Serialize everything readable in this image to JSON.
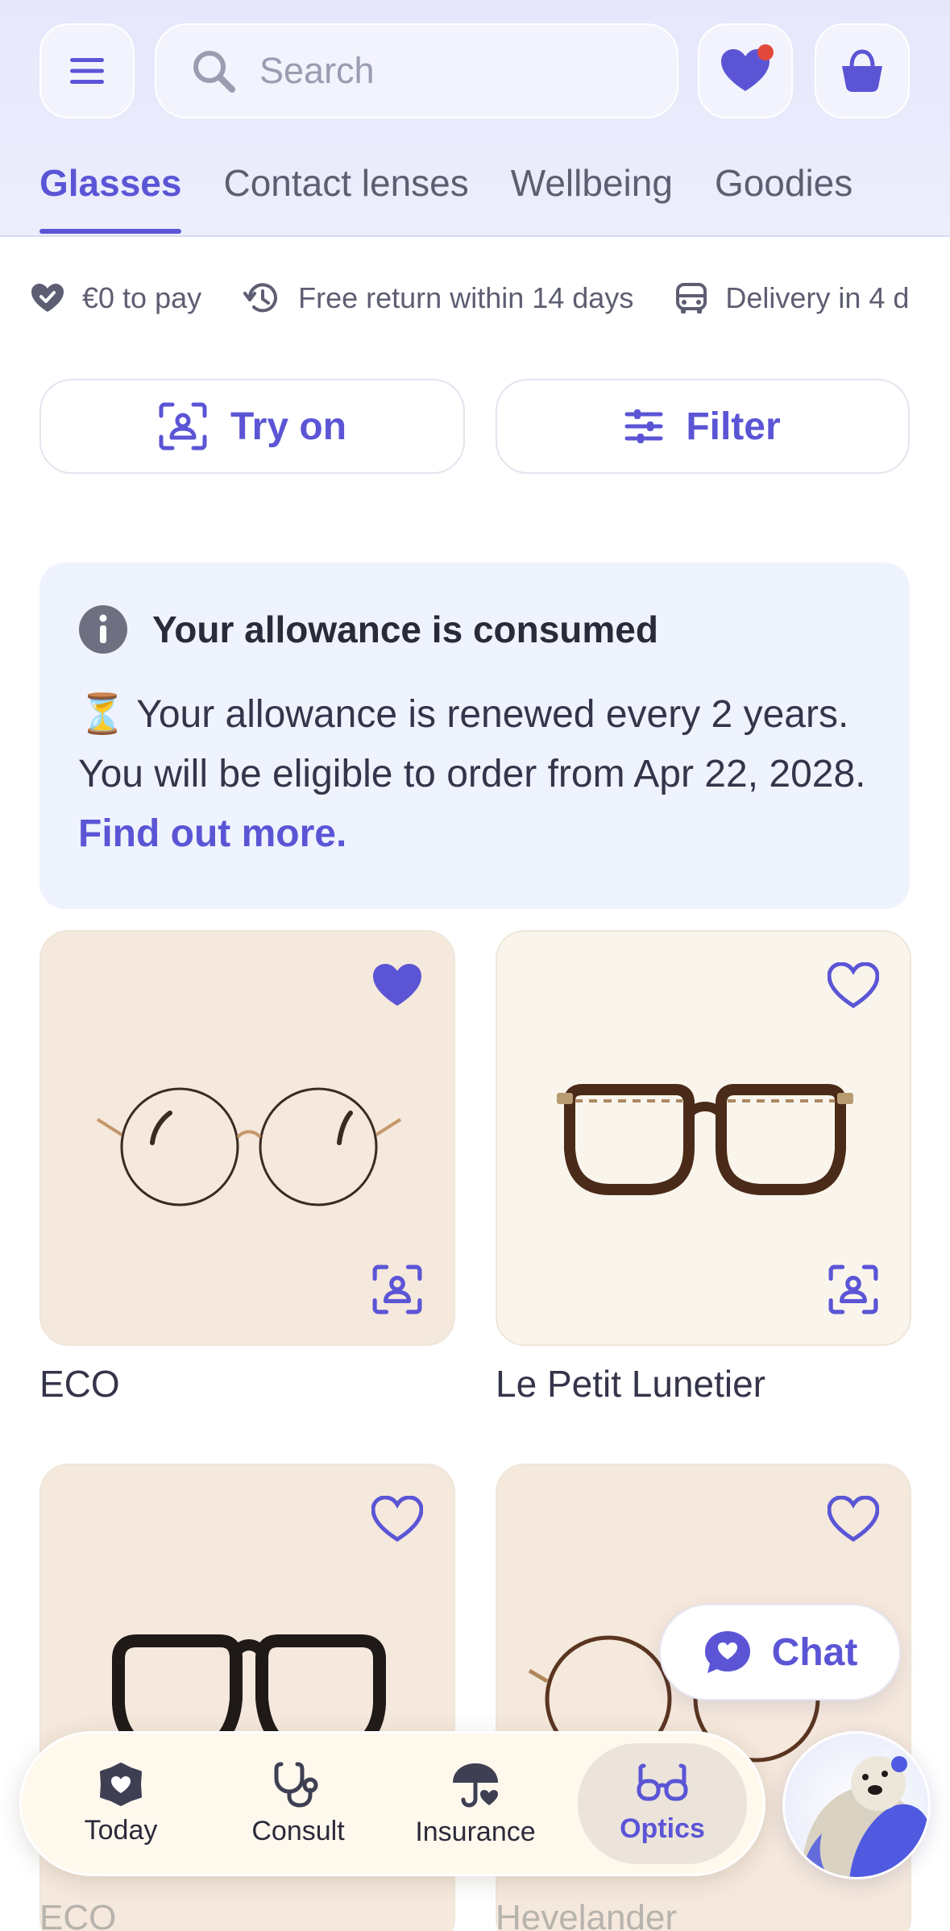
{
  "header": {
    "search_placeholder": "Search",
    "tabs": [
      {
        "label": "Glasses",
        "active": true
      },
      {
        "label": "Contact lenses",
        "active": false
      },
      {
        "label": "Wellbeing",
        "active": false
      },
      {
        "label": "Goodies",
        "active": false
      }
    ],
    "icons": {
      "menu": "menu-icon",
      "search": "search-icon",
      "favorites": "heart-icon",
      "cart": "basket-icon"
    },
    "favorites_notification": true
  },
  "perks": [
    {
      "icon": "heart-check-icon",
      "label": "€0 to pay"
    },
    {
      "icon": "history-icon",
      "label": "Free return within 14 days"
    },
    {
      "icon": "car-icon",
      "label": "Delivery in 4 d"
    }
  ],
  "actions": {
    "try_on": "Try on",
    "filter": "Filter"
  },
  "allowance": {
    "title": "Your allowance is consumed",
    "emoji": "⏳",
    "body": " Your allowance is renewed every 2 years. You will be eligible to order from Apr 22, 2028. ",
    "link": "Find out more."
  },
  "products": [
    {
      "name": "ECO",
      "favorited": true
    },
    {
      "name": "Le Petit Lunetier",
      "favorited": false
    },
    {
      "name": "ECO",
      "favorited": false
    },
    {
      "name": "Hevelander",
      "favorited": false
    }
  ],
  "chat": {
    "label": "Chat"
  },
  "bottom_nav": [
    {
      "label": "Today",
      "icon": "flower-shield-icon",
      "active": false
    },
    {
      "label": "Consult",
      "icon": "stethoscope-icon",
      "active": false
    },
    {
      "label": "Insurance",
      "icon": "umbrella-heart-icon",
      "active": false
    },
    {
      "label": "Optics",
      "icon": "glasses-icon",
      "active": true
    }
  ],
  "colors": {
    "accent": "#5b55d6",
    "header_bg": "#e6e7fb",
    "banner_bg": "#eff3fd",
    "notification": "#e2483b"
  }
}
